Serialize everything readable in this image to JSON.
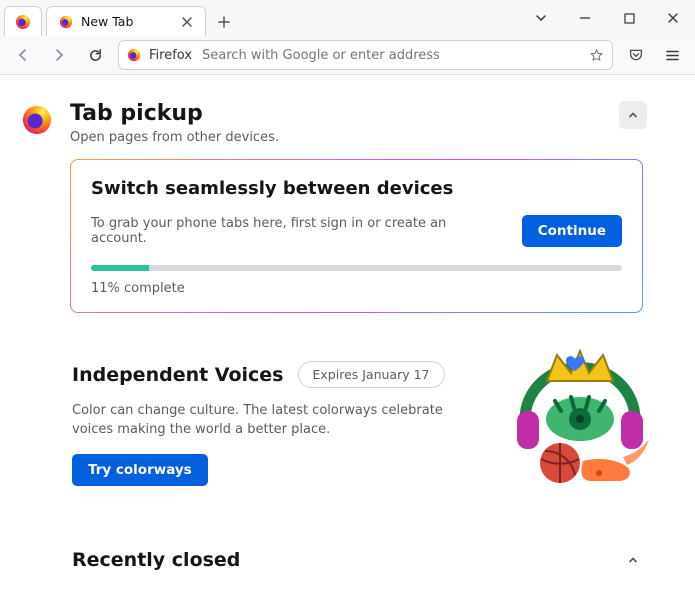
{
  "window": {
    "tab_title": "New Tab"
  },
  "addressbar": {
    "context_label": "Firefox",
    "placeholder": "Search with Google or enter address"
  },
  "pickup": {
    "title": "Tab pickup",
    "subtitle": "Open pages from other devices.",
    "card_title": "Switch seamlessly between devices",
    "card_body": "To grab your phone tabs here, first sign in or create an account.",
    "cta": "Continue",
    "progress_pct": 11,
    "progress_label": "11% complete"
  },
  "voices": {
    "title": "Independent Voices",
    "expires": "Expires January 17",
    "body": "Color can change culture. The latest colorways celebrate voices making the world a better place.",
    "cta": "Try colorways"
  },
  "recent": {
    "title": "Recently closed"
  }
}
